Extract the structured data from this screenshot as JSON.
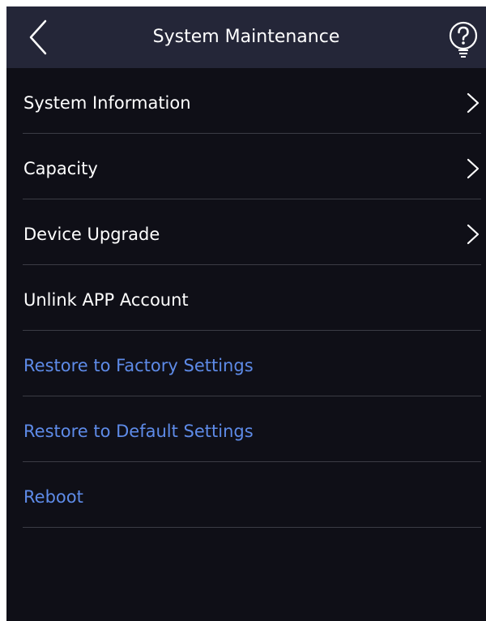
{
  "header": {
    "title": "System Maintenance",
    "back_icon": "chevron-left-icon",
    "help_icon": "question-bulb-icon"
  },
  "menu": {
    "items": [
      {
        "label": "System Information",
        "has_chevron": true,
        "style": "normal"
      },
      {
        "label": "Capacity",
        "has_chevron": true,
        "style": "normal"
      },
      {
        "label": "Device Upgrade",
        "has_chevron": true,
        "style": "normal"
      },
      {
        "label": "Unlink APP Account",
        "has_chevron": false,
        "style": "normal"
      },
      {
        "label": "Restore to Factory Settings",
        "has_chevron": false,
        "style": "action"
      },
      {
        "label": "Restore to Default Settings",
        "has_chevron": false,
        "style": "action"
      },
      {
        "label": "Reboot",
        "has_chevron": false,
        "style": "action"
      }
    ]
  },
  "colors": {
    "background": "#0f0f17",
    "header": "#242638",
    "text": "#ffffff",
    "action_text": "#5e8be8",
    "divider": "#3b3c45"
  }
}
